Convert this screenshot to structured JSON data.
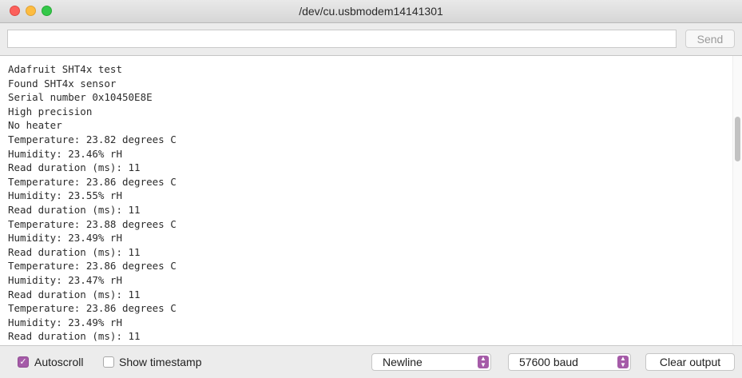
{
  "window": {
    "title": "/dev/cu.usbmodem14141301"
  },
  "input": {
    "value": "",
    "placeholder": "",
    "send_label": "Send"
  },
  "output": {
    "lines": [
      "Adafruit SHT4x test",
      "Found SHT4x sensor",
      "Serial number 0x10450E8E",
      "High precision",
      "No heater",
      "Temperature: 23.82 degrees C",
      "Humidity: 23.46% rH",
      "Read duration (ms): 11",
      "Temperature: 23.86 degrees C",
      "Humidity: 23.55% rH",
      "Read duration (ms): 11",
      "Temperature: 23.88 degrees C",
      "Humidity: 23.49% rH",
      "Read duration (ms): 11",
      "Temperature: 23.86 degrees C",
      "Humidity: 23.47% rH",
      "Read duration (ms): 11",
      "Temperature: 23.86 degrees C",
      "Humidity: 23.49% rH",
      "Read duration (ms): 11"
    ]
  },
  "footer": {
    "autoscroll_label": "Autoscroll",
    "autoscroll_checked": true,
    "timestamp_label": "Show timestamp",
    "timestamp_checked": false,
    "line_ending": "Newline",
    "baud": "57600 baud",
    "clear_label": "Clear output"
  },
  "colors": {
    "accent": "#a55ba8",
    "close": "#fc605b",
    "minimize": "#fdbc40",
    "maximize": "#34c84a"
  },
  "icons": {
    "checkbox_checked": "check-icon",
    "select_arrow": "updown-arrow-icon"
  }
}
